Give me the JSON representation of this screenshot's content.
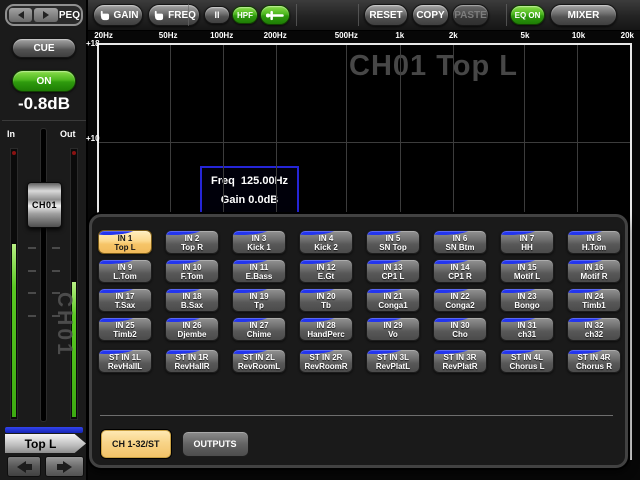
{
  "colors": {
    "accent_green": "#3fae14",
    "accent_amber": "#f8d084",
    "accent_blue": "#2335ee",
    "meter_green": "#55c822",
    "peak_led_red": "#8a1212"
  },
  "sidebar": {
    "peq_label": "PEQ",
    "cue_label": "CUE",
    "on_label": "ON",
    "gain_value": "-0.8dB",
    "meter_in_label": "In",
    "meter_out_label": "Out",
    "fader_cap_label": "CH01",
    "channel_watermark": "CH01",
    "channel_name": "Top L"
  },
  "toolbar": {
    "gain_label": "GAIN",
    "freq_label": "FREQ",
    "band_label": "II",
    "hpf_label": "HPF",
    "reset_label": "RESET",
    "copy_label": "COPY",
    "paste_label": "PASTE",
    "eq_on_label": "EQ ON",
    "mixer_label": "MIXER"
  },
  "eq_graph": {
    "freq_ticks": [
      "20Hz",
      "50Hz",
      "100Hz",
      "200Hz",
      "500Hz",
      "1k",
      "2k",
      "5k",
      "10k",
      "20k"
    ],
    "gain_ticks": [
      "+18",
      "+10"
    ],
    "watermark": "CH01 Top L",
    "info_box": {
      "freq": "Freq  125.00Hz",
      "gain": "Gain 0.0dB"
    }
  },
  "channel_select": {
    "tabs": [
      {
        "label": "CH 1-32/ST",
        "selected": true
      },
      {
        "label": "OUTPUTS",
        "selected": false
      }
    ],
    "channels": [
      {
        "num": "IN 1",
        "label": "Top L",
        "selected": true
      },
      {
        "num": "IN 2",
        "label": "Top R"
      },
      {
        "num": "IN 3",
        "label": "Kick 1"
      },
      {
        "num": "IN 4",
        "label": "Kick 2"
      },
      {
        "num": "IN 5",
        "label": "SN Top"
      },
      {
        "num": "IN 6",
        "label": "SN Btm"
      },
      {
        "num": "IN 7",
        "label": "HH"
      },
      {
        "num": "IN 8",
        "label": "H.Tom"
      },
      {
        "num": "IN 9",
        "label": "L.Tom"
      },
      {
        "num": "IN 10",
        "label": "F.Tom"
      },
      {
        "num": "IN 11",
        "label": "E.Bass"
      },
      {
        "num": "IN 12",
        "label": "E.Gt"
      },
      {
        "num": "IN 13",
        "label": "CP1 L"
      },
      {
        "num": "IN 14",
        "label": "CP1 R"
      },
      {
        "num": "IN 15",
        "label": "Motif L"
      },
      {
        "num": "IN 16",
        "label": "Motif R"
      },
      {
        "num": "IN 17",
        "label": "T.Sax"
      },
      {
        "num": "IN 18",
        "label": "B.Sax"
      },
      {
        "num": "IN 19",
        "label": "Tp"
      },
      {
        "num": "IN 20",
        "label": "Tb"
      },
      {
        "num": "IN 21",
        "label": "Conga1"
      },
      {
        "num": "IN 22",
        "label": "Conga2"
      },
      {
        "num": "IN 23",
        "label": "Bongo"
      },
      {
        "num": "IN 24",
        "label": "Timb1"
      },
      {
        "num": "IN 25",
        "label": "Timb2"
      },
      {
        "num": "IN 26",
        "label": "Djembe"
      },
      {
        "num": "IN 27",
        "label": "Chime"
      },
      {
        "num": "IN 28",
        "label": "HandPerc"
      },
      {
        "num": "IN 29",
        "label": "Vo"
      },
      {
        "num": "IN 30",
        "label": "Cho"
      },
      {
        "num": "IN 31",
        "label": "ch31"
      },
      {
        "num": "IN 32",
        "label": "ch32"
      },
      {
        "num": "ST IN 1L",
        "label": "RevHallL"
      },
      {
        "num": "ST IN 1R",
        "label": "RevHallR"
      },
      {
        "num": "ST IN 2L",
        "label": "RevRoomL"
      },
      {
        "num": "ST IN 2R",
        "label": "RevRoomR"
      },
      {
        "num": "ST IN 3L",
        "label": "RevPlatL"
      },
      {
        "num": "ST IN 3R",
        "label": "RevPlatR"
      },
      {
        "num": "ST IN 4L",
        "label": "Chorus L"
      },
      {
        "num": "ST IN 4R",
        "label": "Chorus R"
      }
    ]
  }
}
